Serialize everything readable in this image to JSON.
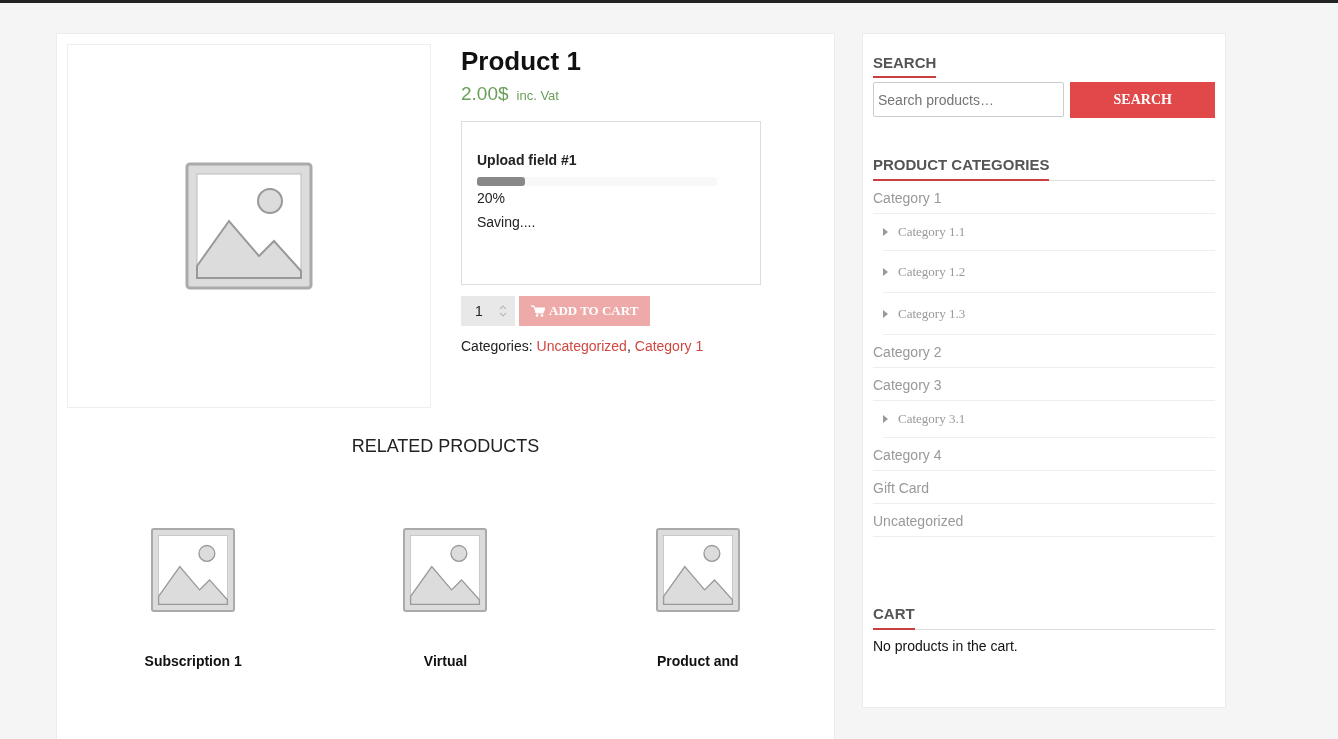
{
  "product": {
    "title": "Product 1",
    "price": "2.00$",
    "price_suffix": "inc. Vat",
    "upload": {
      "label": "Upload field #1",
      "level": 0.2,
      "reading": "20%",
      "status": "Saving...."
    },
    "quantity": "1",
    "add_to_cart": {
      "label": "ADD TO CART",
      "disabled": true
    },
    "categories_label": "Categories:",
    "categories_separator": ",",
    "categories": [
      "Uncategorized",
      "Category 1"
    ]
  },
  "related": {
    "title": "RELATED PRODUCTS",
    "items": [
      {
        "name": "Subscription 1"
      },
      {
        "name": "Virtual"
      },
      {
        "name": "Product and"
      }
    ]
  },
  "sidebar": {
    "search": {
      "title": "SEARCH",
      "placeholder": "Search products…",
      "button": "SEARCH"
    },
    "categories": {
      "title": "PRODUCT CATEGORIES",
      "items": [
        {
          "label": "Category 1",
          "children": [
            {
              "label": "Category 1.1"
            },
            {
              "label": "Category 1.2"
            },
            {
              "label": "Category 1.3"
            }
          ]
        },
        {
          "label": "Category 2"
        },
        {
          "label": "Category 3",
          "children": [
            {
              "label": "Category 3.1"
            }
          ]
        },
        {
          "label": "Category 4"
        },
        {
          "label": "Gift Card"
        },
        {
          "label": "Uncategorized"
        }
      ]
    },
    "cart": {
      "title": "CART",
      "text": "No products in the cart."
    }
  }
}
